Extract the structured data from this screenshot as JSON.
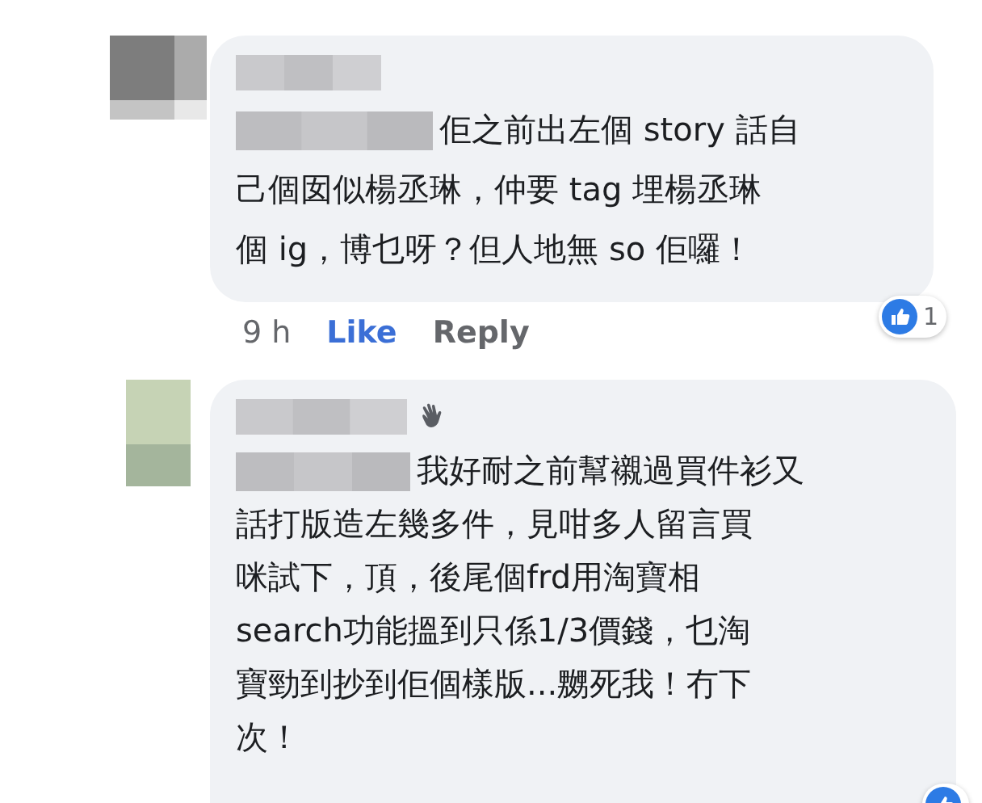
{
  "comments": [
    {
      "lines": [
        "佢之前出左個 story 話自",
        "己個囡似楊丞琳，仲要 tag 埋楊丞琳",
        "個 ig，博乜呀？但人地無 so 佢囉！"
      ],
      "wave": false,
      "time": "9 h",
      "actions": [
        "Like",
        "Reply"
      ],
      "reaction_count": "1"
    },
    {
      "lines": [
        "我好耐之前幫襯過買件衫又",
        "話打版造左幾多件，見咁多人留言買",
        "咪試下，頂，後尾個frd用淘寶相",
        "search功能搵到只係1/3價錢，乜淘",
        "寶勁到抄到佢個樣版...嬲死我！冇下",
        "次！"
      ],
      "wave": true
    }
  ]
}
